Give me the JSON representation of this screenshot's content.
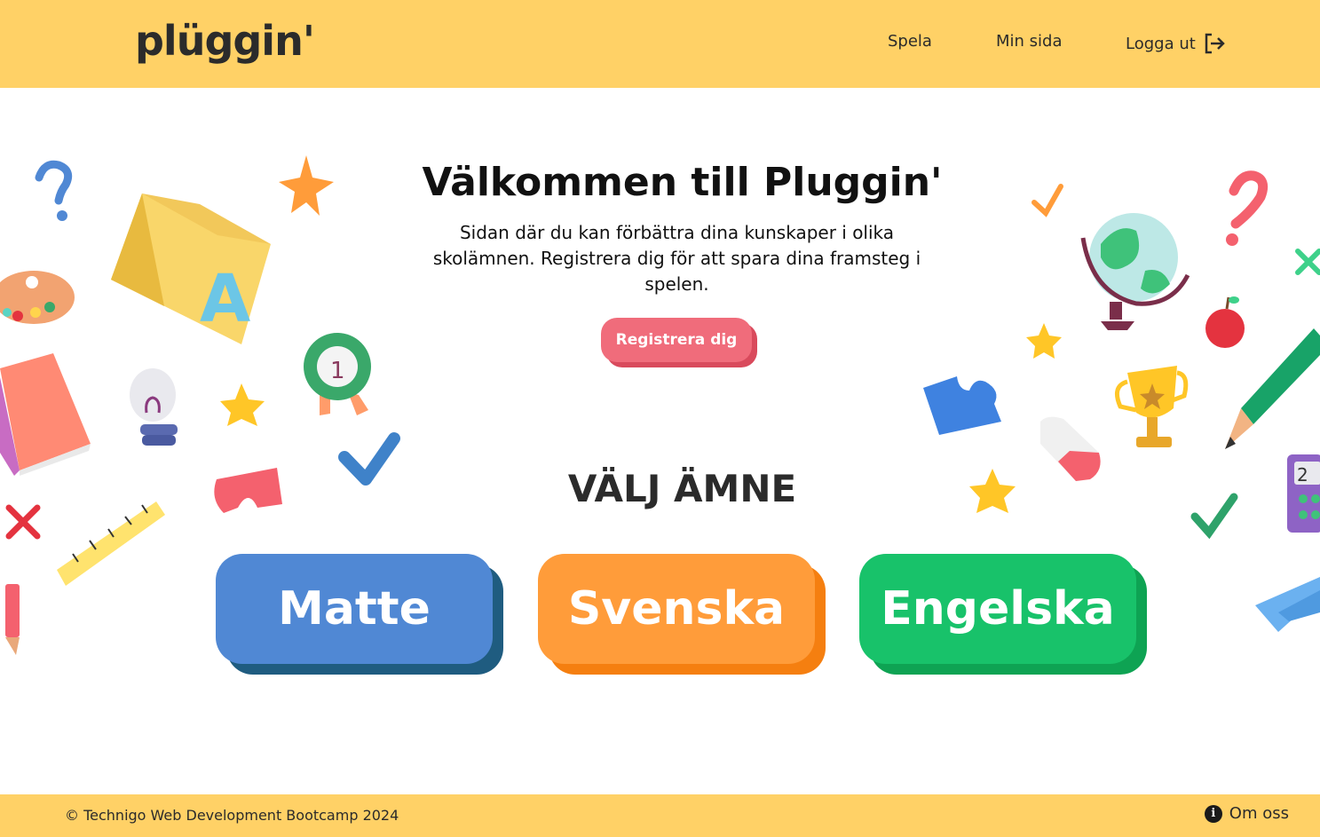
{
  "header": {
    "logo": "plüggin'",
    "nav": {
      "play": "Spela",
      "my_page": "Min sida",
      "logout": "Logga ut"
    }
  },
  "hero": {
    "title": "Välkommen till Pluggin'",
    "description": "Sidan där du kan förbättra dina kunskaper i olika skolämnen. Registrera dig för att spara dina framsteg i spelen.",
    "register_label": "Registrera dig"
  },
  "subjects": {
    "heading": "VÄLJ ÄMNE",
    "items": [
      {
        "label": "Matte",
        "color": "#5088d4",
        "shadow": "#1f5c80"
      },
      {
        "label": "Svenska",
        "color": "#ff9c3a",
        "shadow": "#f57f10"
      },
      {
        "label": "Engelska",
        "color": "#18c26a",
        "shadow": "#0ea353"
      }
    ]
  },
  "footer": {
    "copyright": "© Technigo Web Development Bootcamp 2024",
    "about": "Om oss"
  },
  "colors": {
    "header_bg": "#ffd166",
    "register_btn": "#f06c7b"
  }
}
